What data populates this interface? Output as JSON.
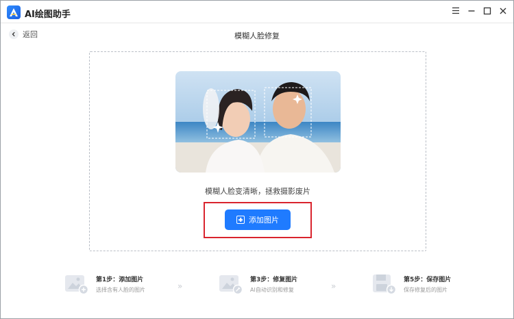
{
  "app": {
    "title": "AI绘图助手"
  },
  "header": {
    "back_label": "返回",
    "page_title": "模糊人脸修复"
  },
  "main": {
    "description": "模糊人脸变清晰，拯救摄影废片",
    "add_button_label": "添加图片"
  },
  "steps": [
    {
      "title": "第1步：添加图片",
      "subtitle": "选择含有人脸的图片"
    },
    {
      "title": "第3步：修复图片",
      "subtitle": "AI自动识别和修复"
    },
    {
      "title": "第5步：保存图片",
      "subtitle": "保存修复后的图片"
    }
  ],
  "colors": {
    "accent": "#1f7bff",
    "highlight": "#d9232d"
  },
  "icons": {
    "logo": "app-logo-icon",
    "menu": "menu-icon",
    "minimize": "minimize-icon",
    "maximize": "maximize-icon",
    "close": "close-icon",
    "back": "chevron-left-icon"
  }
}
